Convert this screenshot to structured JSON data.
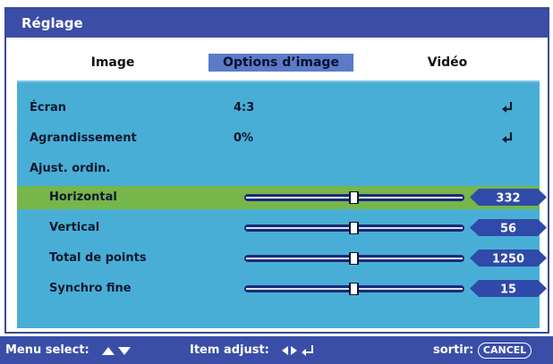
{
  "window": {
    "title": "Réglage"
  },
  "tabs": [
    {
      "label": "Image",
      "active": false
    },
    {
      "label": "Options d’image",
      "active": true
    },
    {
      "label": "Vidéo",
      "active": false
    }
  ],
  "settings": {
    "ecran": {
      "label": "Écran",
      "value": "4:3",
      "icon": "enter-icon"
    },
    "agrandissement": {
      "label": "Agrandissement",
      "value": "0%",
      "icon": "enter-icon"
    },
    "ajust": {
      "label": "Ajust. ordin."
    },
    "sliders": [
      {
        "label": "Horizontal",
        "value": "332",
        "selected": true
      },
      {
        "label": "Vertical",
        "value": "56",
        "selected": false
      },
      {
        "label": "Total de points",
        "value": "1250",
        "selected": false
      },
      {
        "label": "Synchro fine",
        "value": "15",
        "selected": false
      }
    ]
  },
  "footer": {
    "menu_select": "Menu select:",
    "item_adjust": "Item adjust:",
    "sortir": "sortir:",
    "cancel": "CANCEL"
  },
  "colors": {
    "titlebar": "#3c4da7",
    "panel": "#49aed6",
    "selected_row": "#76b64a",
    "active_tab": "#5b7bc8",
    "value_badge": "#2f4aa8"
  }
}
